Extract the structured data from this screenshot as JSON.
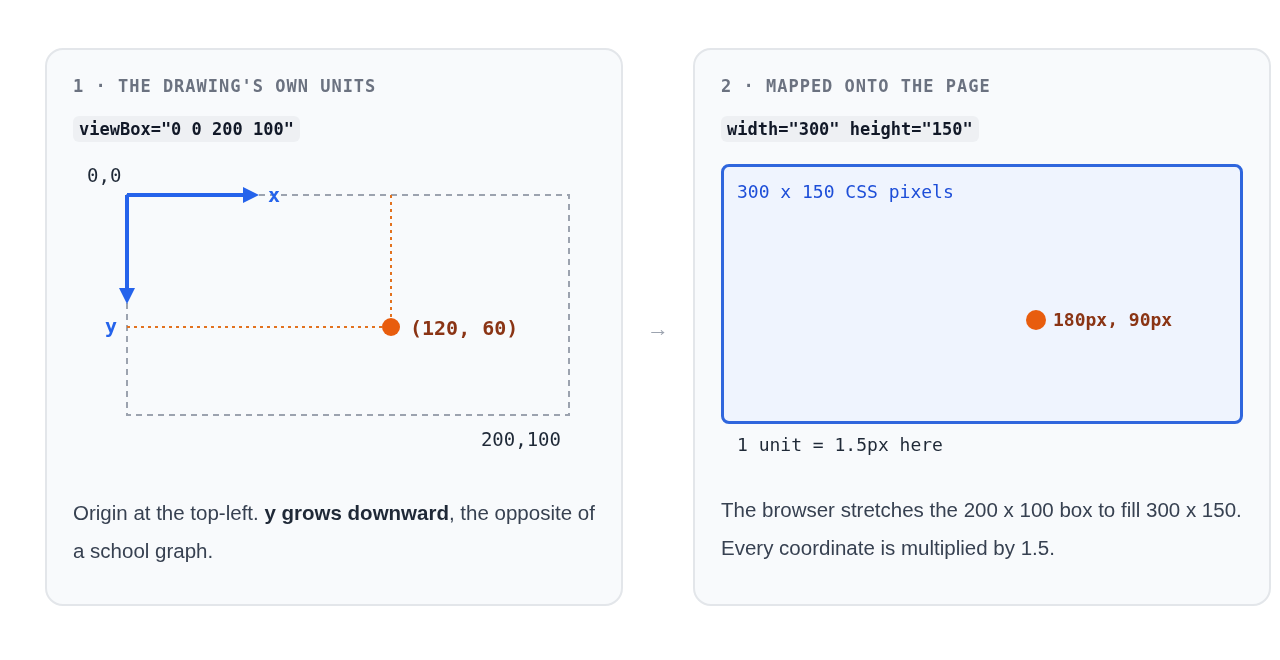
{
  "panels": [
    {
      "kind": "axes",
      "title": "1 · THE DRAWING'S OWN UNITS",
      "code": "viewBox=\"0 0 200 100\"",
      "origin_label": "0,0",
      "x_label": "x",
      "y_label": "y",
      "point_label": "(120, 60)",
      "corner_label": "200,100",
      "description": "Origin at the top-left. **y grows downward**, the opposite of a school graph."
    },
    {
      "kind": "mapped",
      "title": "2 · MAPPED ONTO THE PAGE",
      "code": "width=\"300\" height=\"150\"",
      "box_label": "300 x 150 CSS pixels",
      "point_label": "180px, 90px",
      "caption": "1 unit = 1.5px here",
      "description": "The browser stretches the 200 x 100 box to fill 300 x 150. Every coordinate is multiplied by 1.5."
    }
  ],
  "connector": "→"
}
